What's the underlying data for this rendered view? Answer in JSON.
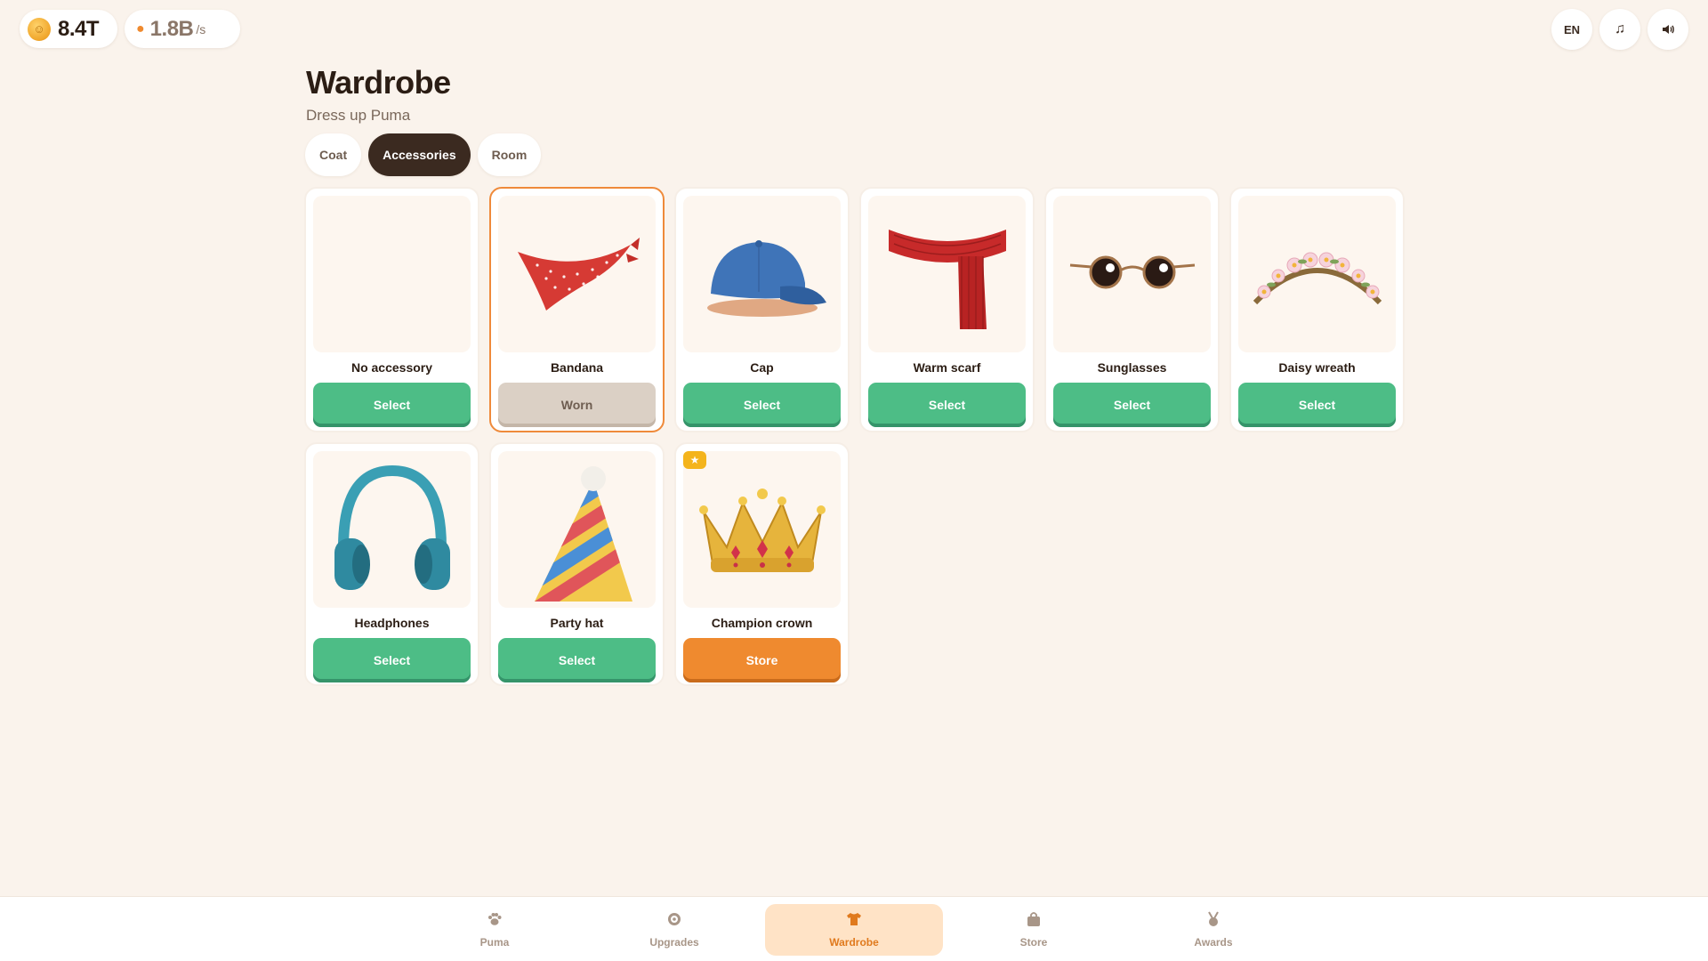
{
  "topbar": {
    "coins": "8.4T",
    "rate": "1.8B",
    "rate_unit": "/s",
    "language": "EN",
    "coin_icon": "coin-icon",
    "paw_icon": "paw-icon",
    "music_icon": "music-note-icon",
    "sound_icon": "speaker-icon"
  },
  "header": {
    "title": "Wardrobe",
    "subtitle": "Dress up Puma"
  },
  "tabs": [
    {
      "label": "Coat",
      "active": false
    },
    {
      "label": "Accessories",
      "active": true
    },
    {
      "label": "Room",
      "active": false
    }
  ],
  "items": [
    {
      "name": "No accessory",
      "action": "Select",
      "state": "select"
    },
    {
      "name": "Bandana",
      "action": "Worn",
      "state": "worn"
    },
    {
      "name": "Cap",
      "action": "Select",
      "state": "select"
    },
    {
      "name": "Warm scarf",
      "action": "Select",
      "state": "select"
    },
    {
      "name": "Sunglasses",
      "action": "Select",
      "state": "select"
    },
    {
      "name": "Daisy wreath",
      "action": "Select",
      "state": "select"
    },
    {
      "name": "Headphones",
      "action": "Select",
      "state": "select"
    },
    {
      "name": "Party hat",
      "action": "Select",
      "state": "select"
    },
    {
      "name": "Champion crown",
      "action": "Store",
      "state": "store",
      "badge": "★"
    }
  ],
  "nav": [
    {
      "label": "Puma",
      "icon": "paw-icon",
      "active": false
    },
    {
      "label": "Upgrades",
      "icon": "gear-icon",
      "active": false
    },
    {
      "label": "Wardrobe",
      "icon": "shirt-icon",
      "active": true
    },
    {
      "label": "Store",
      "icon": "bag-icon",
      "active": false
    },
    {
      "label": "Awards",
      "icon": "medal-icon",
      "active": false
    }
  ],
  "colors": {
    "background": "#faf3ec",
    "select_button": "#4dbd86",
    "store_button": "#ef8a2f",
    "worn_border": "#ef8a3a",
    "active_tab": "#3b2a20"
  }
}
